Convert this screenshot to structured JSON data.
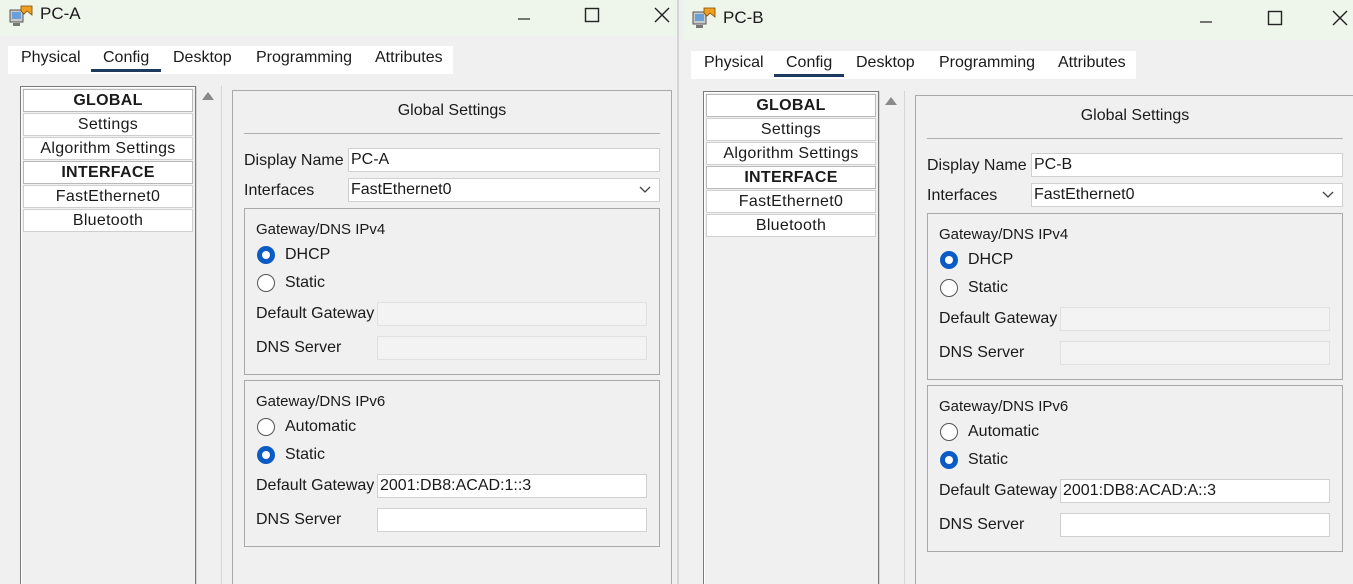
{
  "windows": [
    {
      "title": "PC-A",
      "tabs": [
        "Physical",
        "Config",
        "Desktop",
        "Programming",
        "Attributes"
      ],
      "active_tab": "Config",
      "sidebar": [
        "GLOBAL",
        "Settings",
        "Algorithm Settings",
        "INTERFACE",
        "FastEthernet0",
        "Bluetooth"
      ],
      "panel_title": "Global Settings",
      "display_name_label": "Display Name",
      "display_name": "PC-A",
      "interfaces_label": "Interfaces",
      "interface": "FastEthernet0",
      "ipv4": {
        "title": "Gateway/DNS IPv4",
        "dhcp": "DHCP",
        "static": "Static",
        "selected": "DHCP",
        "gateway_label": "Default Gateway",
        "gateway": "",
        "dns_label": "DNS Server",
        "dns": ""
      },
      "ipv6": {
        "title": "Gateway/DNS IPv6",
        "automatic": "Automatic",
        "static": "Static",
        "selected": "Static",
        "gateway_label": "Default Gateway",
        "gateway": "2001:DB8:ACAD:1::3",
        "dns_label": "DNS Server",
        "dns": ""
      }
    },
    {
      "title": "PC-B",
      "tabs": [
        "Physical",
        "Config",
        "Desktop",
        "Programming",
        "Attributes"
      ],
      "active_tab": "Config",
      "sidebar": [
        "GLOBAL",
        "Settings",
        "Algorithm Settings",
        "INTERFACE",
        "FastEthernet0",
        "Bluetooth"
      ],
      "panel_title": "Global Settings",
      "display_name_label": "Display Name",
      "display_name": "PC-B",
      "interfaces_label": "Interfaces",
      "interface": "FastEthernet0",
      "ipv4": {
        "title": "Gateway/DNS IPv4",
        "dhcp": "DHCP",
        "static": "Static",
        "selected": "DHCP",
        "gateway_label": "Default Gateway",
        "gateway": "",
        "dns_label": "DNS Server",
        "dns": ""
      },
      "ipv6": {
        "title": "Gateway/DNS IPv6",
        "automatic": "Automatic",
        "static": "Static",
        "selected": "Static",
        "gateway_label": "Default Gateway",
        "gateway": "2001:DB8:ACAD:A::3",
        "dns_label": "DNS Server",
        "dns": ""
      }
    }
  ],
  "colors": {
    "accent": "#0a5bc4",
    "tab_underline": "#1c3a5f",
    "titlebar": "#eef5ea"
  }
}
